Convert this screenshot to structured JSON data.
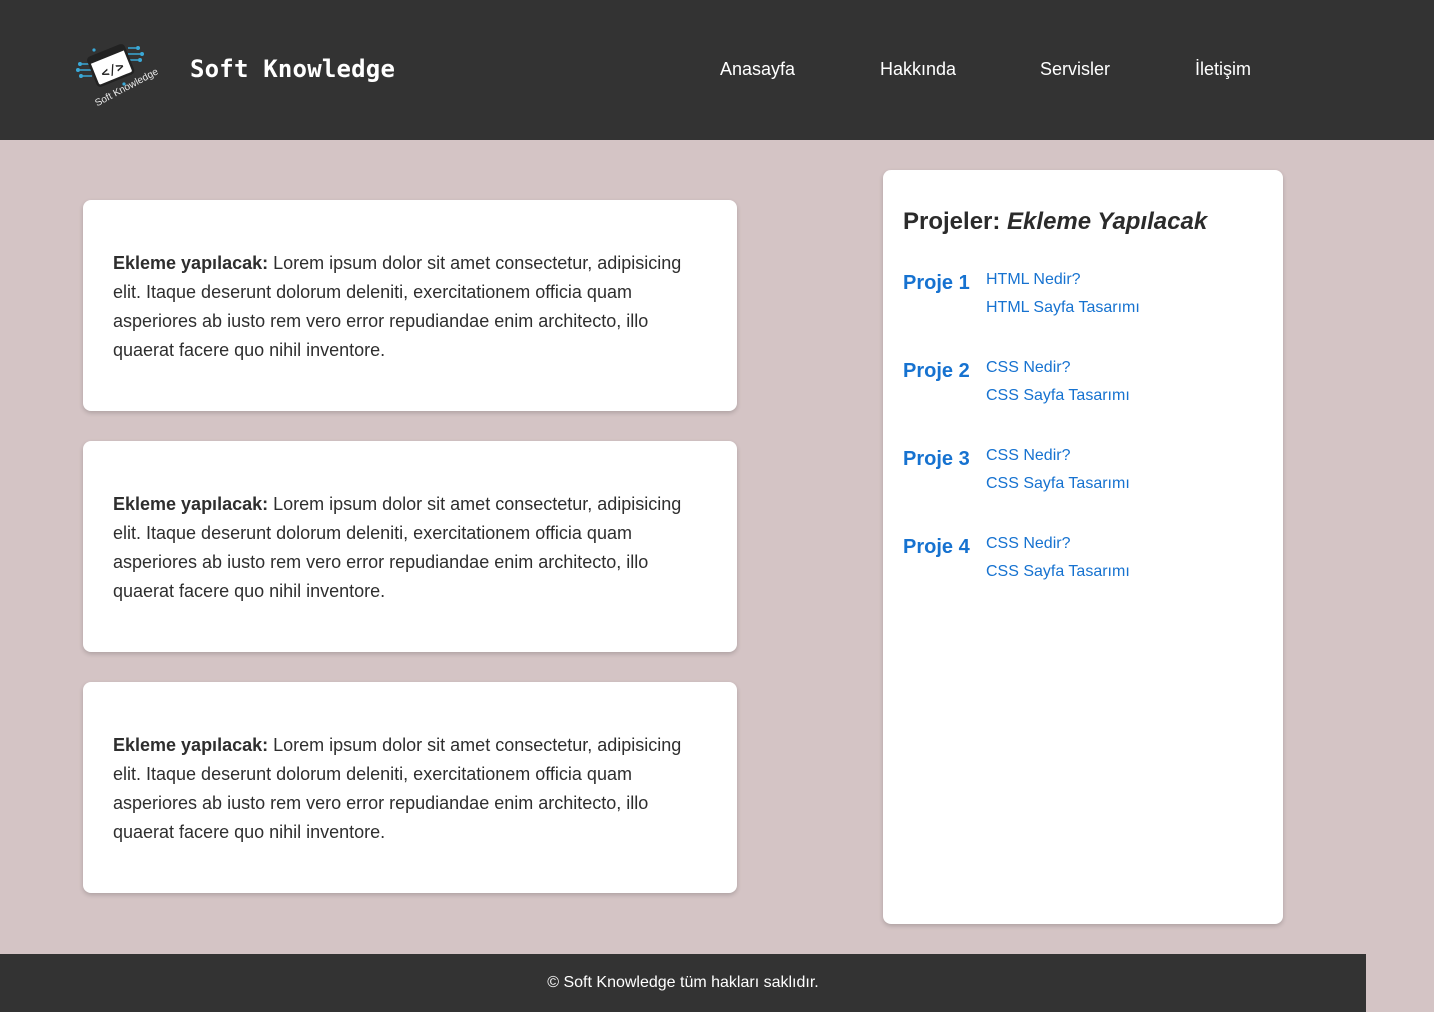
{
  "header": {
    "logo_text": "Soft Knowledge",
    "brand": "Soft Knowledge",
    "nav": [
      "Anasayfa",
      "Hakkında",
      "Servisler",
      "İletişim"
    ]
  },
  "cards": [
    {
      "bold": "Ekleme yapılacak:",
      "text": " Lorem ipsum dolor sit amet consectetur, adipisicing elit. Itaque deserunt dolorum deleniti, exercitationem officia quam asperiores ab iusto rem vero error repudiandae enim architecto, illo quaerat facere quo nihil inventore."
    },
    {
      "bold": "Ekleme yapılacak:",
      "text": " Lorem ipsum dolor sit amet consectetur, adipisicing elit. Itaque deserunt dolorum deleniti, exercitationem officia quam asperiores ab iusto rem vero error repudiandae enim architecto, illo quaerat facere quo nihil inventore."
    },
    {
      "bold": "Ekleme yapılacak:",
      "text": " Lorem ipsum dolor sit amet consectetur, adipisicing elit. Itaque deserunt dolorum deleniti, exercitationem officia quam asperiores ab iusto rem vero error repudiandae enim architecto, illo quaerat facere quo nihil inventore."
    }
  ],
  "sidebar": {
    "title": "Projeler:",
    "title_italic": "Ekleme Yapılacak",
    "projects": [
      {
        "name": "Proje 1",
        "links": [
          "HTML Nedir?",
          "HTML Sayfa Tasarımı"
        ]
      },
      {
        "name": "Proje 2",
        "links": [
          "CSS Nedir?",
          "CSS Sayfa Tasarımı"
        ]
      },
      {
        "name": "Proje 3",
        "links": [
          "CSS Nedir?",
          "CSS Sayfa Tasarımı"
        ]
      },
      {
        "name": "Proje 4",
        "links": [
          "CSS Nedir?",
          "CSS Sayfa Tasarımı"
        ]
      }
    ]
  },
  "footer": {
    "text": "© Soft Knowledge tüm hakları saklıdır."
  },
  "colors": {
    "header_bg": "#333333",
    "page_bg": "#d4c4c5",
    "link_blue": "#1672d0",
    "logo_accent": "#3aa9d8"
  }
}
